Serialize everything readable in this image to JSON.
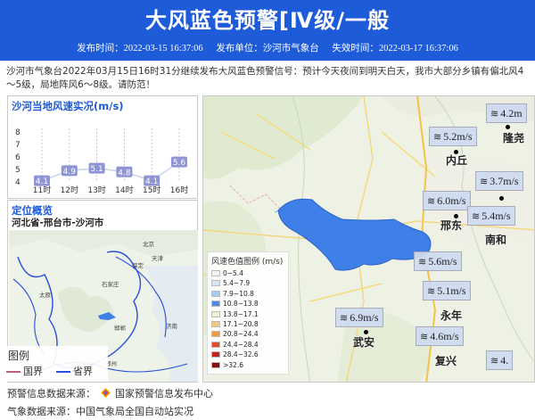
{
  "header": {
    "title": "大风蓝色预警[Ⅳ级/一般",
    "publish_time": "发布时间：2022-03-15 16:37:06",
    "publisher": "发布单位：沙河市气象台",
    "expire_time": "失效时间：2022-03-17 16:37:06"
  },
  "description": "沙河市气象台2022年03月15日16时31分继续发布大风蓝色预警信号：预计今天夜间到明天白天，我市大部分乡镇有偏北风4～5级，局地阵风6～8级。请防范！",
  "wind_panel": {
    "title": "沙河当地风速实况(m/s)"
  },
  "chart_data": {
    "type": "line",
    "title": "沙河当地风速实况(m/s)",
    "categories": [
      "11时",
      "12时",
      "13时",
      "14时",
      "15时",
      "16时"
    ],
    "values": [
      4.1,
      4.9,
      5.1,
      4.8,
      4.1,
      5.6
    ],
    "y_ticks": [
      "4",
      "5",
      "6",
      "7",
      "8"
    ],
    "ylim": [
      4,
      8
    ],
    "grid": "vertical-dashed",
    "colors": {
      "line": "#c9d4ee",
      "label_bg": "#8f95d3"
    }
  },
  "location_panel": {
    "title": "定位概览",
    "region": "河北省-邢台市-沙河市",
    "map_labels": [
      "北京",
      "天津",
      "保定",
      "石家庄",
      "太原",
      "邯郸",
      "济南",
      "郑州"
    ]
  },
  "mini_legend": {
    "title": "图例",
    "items": [
      {
        "label": "国界",
        "color": "#c0607a"
      },
      {
        "label": "省界",
        "color": "#2a4fd8"
      }
    ]
  },
  "speed_legend": {
    "title": "风速色值图例 (m/s)",
    "items": [
      {
        "label": "0~5.4",
        "color": "#f2f2f2"
      },
      {
        "label": "5.4~7.9",
        "color": "#d6e8f7"
      },
      {
        "label": "7.9~10.8",
        "color": "#a7cdee"
      },
      {
        "label": "10.8~13.8",
        "color": "#4f8be6"
      },
      {
        "label": "13.8~17.1",
        "color": "#f3eed6"
      },
      {
        "label": "17.1~20.8",
        "color": "#f6c97a"
      },
      {
        "label": "20.8~24.4",
        "color": "#f39a3a"
      },
      {
        "label": "24.4~28.4",
        "color": "#e0502a"
      },
      {
        "label": "28.4~32.6",
        "color": "#c02320"
      },
      {
        "label": ">32.6",
        "color": "#8a0d0d"
      }
    ]
  },
  "map": {
    "wind_labels": [
      "4.2m",
      "5.2m/s",
      "3.7m/s",
      "6.0m/s",
      "5.4m/s",
      "5.6m/s",
      "5.1m/s",
      "6.9m/s",
      "4.6m/s",
      "4."
    ],
    "wind_icon": "≋",
    "cities": [
      "隆尧",
      "内丘",
      "邢东",
      "南和",
      "永年",
      "武安",
      "复兴"
    ],
    "warning_area_color": "#3f80e8"
  },
  "sources": {
    "warning": "预警信息数据来源：",
    "warning_org": "国家预警信息发布中心",
    "weather": "气象数据来源：中国气象局全国自动站实况"
  }
}
